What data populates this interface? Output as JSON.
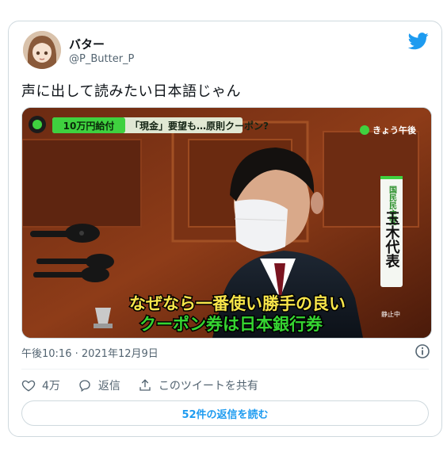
{
  "user": {
    "name": "バター",
    "handle": "@P_Butter_P"
  },
  "tweet": {
    "text": "声に出して読みたい日本語じゃん"
  },
  "media": {
    "ticker_label": "10万円給付",
    "ticker_text": "「現金」要望も…原則クーポン?",
    "channel": "きょう午後",
    "name_caption_role": "国民民主党",
    "name_caption_name": "玉木代表",
    "subtitle_line1": "なぜなら一番使い勝手の良い",
    "subtitle_line2": "クーポン券は日本銀行券",
    "small_tag": "静止中"
  },
  "meta": {
    "timestamp": "午後10:16 · 2021年12月9日"
  },
  "actions": {
    "likes": "4万",
    "reply_label": "返信",
    "share_label": "このツイートを共有"
  },
  "read_replies": "52件の返信を読む",
  "colors": {
    "accent": "#1d9bf0",
    "ticker_green": "#3fd13f",
    "subtitle_yellow": "#f7e54a",
    "subtitle_green": "#35d431"
  },
  "icons": [
    "twitter-logo-icon",
    "info-icon",
    "heart-icon",
    "reply-icon",
    "share-icon"
  ]
}
